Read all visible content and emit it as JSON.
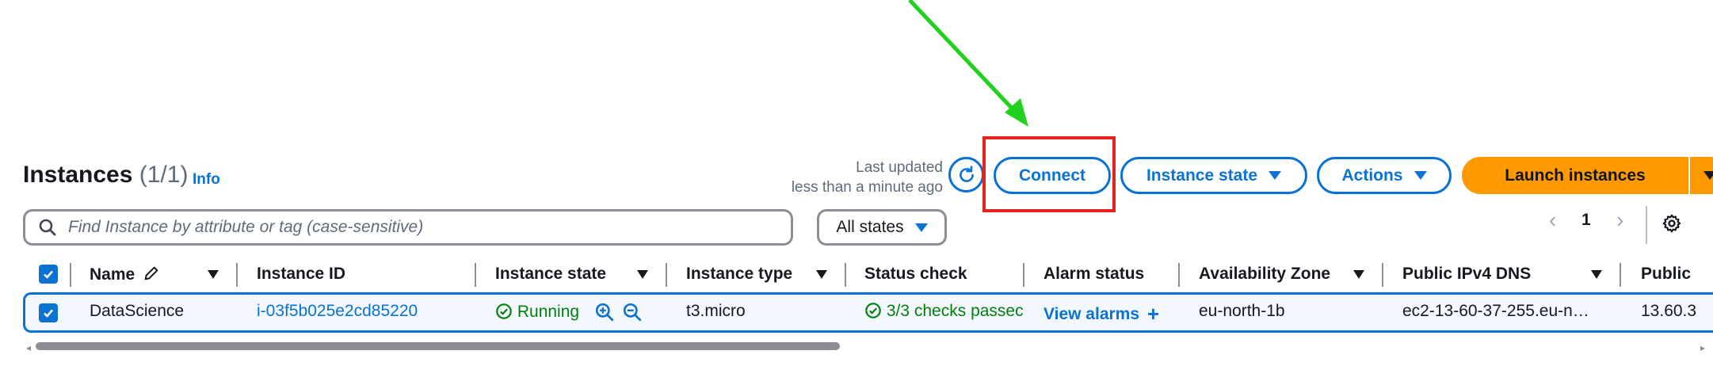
{
  "header": {
    "title": "Instances",
    "count": "(1/1)",
    "info_label": "Info",
    "last_updated_label": "Last updated",
    "last_updated_value": "less than a minute ago"
  },
  "toolbar": {
    "refresh_icon": "refresh-icon",
    "connect_label": "Connect",
    "instance_state_label": "Instance state",
    "actions_label": "Actions",
    "launch_label": "Launch instances"
  },
  "filter": {
    "search_placeholder": "Find Instance by attribute or tag (case-sensitive)",
    "state_filter_value": "All states"
  },
  "pagination": {
    "current_page": "1"
  },
  "table": {
    "columns": [
      "Name",
      "Instance ID",
      "Instance state",
      "Instance type",
      "Status check",
      "Alarm status",
      "Availability Zone",
      "Public IPv4 DNS",
      "Public"
    ],
    "rows": [
      {
        "selected": true,
        "name": "DataScience",
        "instance_id": "i-03f5b025e2cd85220",
        "state": "Running",
        "type": "t3.micro",
        "status_check": "3/3 checks passec",
        "alarm": "View alarms",
        "az": "eu-north-1b",
        "dns": "ec2-13-60-37-255.eu-n…",
        "public_ip": "13.60.3"
      }
    ]
  },
  "annotation": {
    "arrow_color": "#22d11e",
    "highlight_color": "#e5221c"
  },
  "colors": {
    "accent": "#0972d3",
    "launch": "#ff9900",
    "success": "#037f0c"
  }
}
